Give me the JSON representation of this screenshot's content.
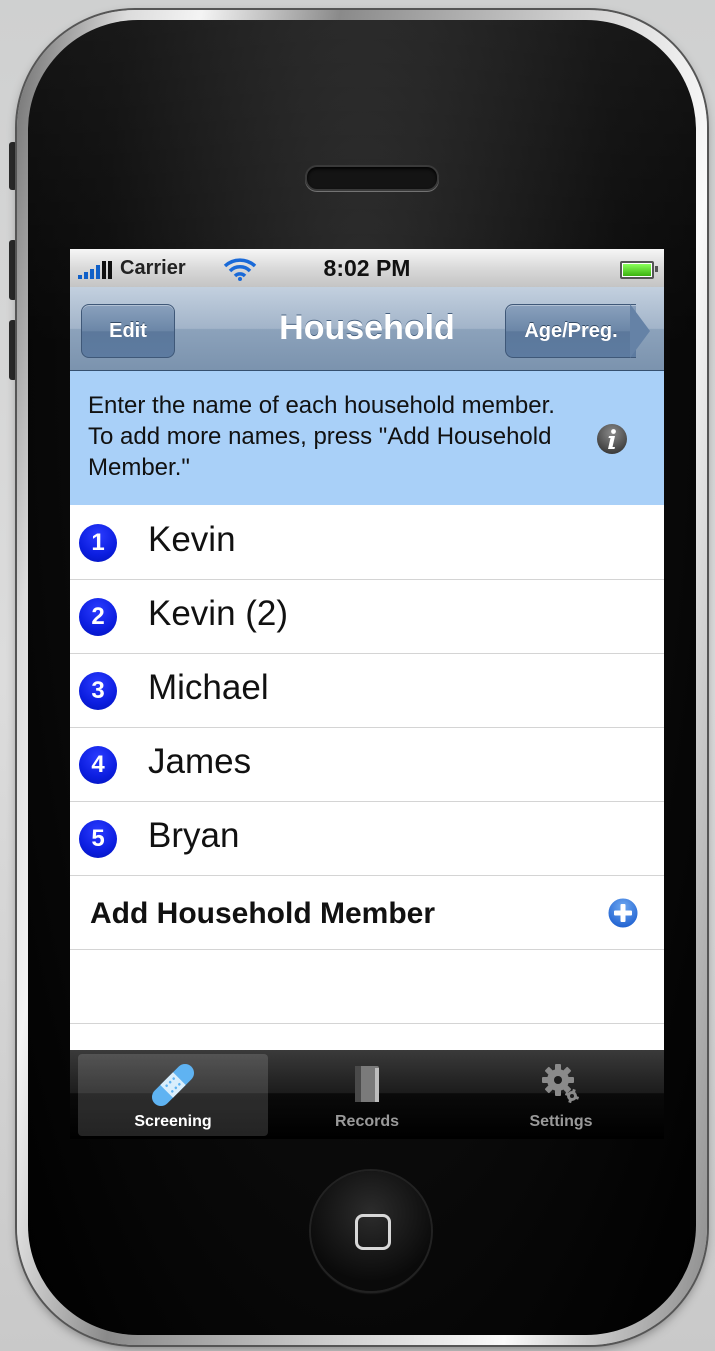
{
  "status_bar": {
    "carrier": "Carrier",
    "time": "8:02 PM"
  },
  "nav_bar": {
    "title": "Household",
    "left_button": "Edit",
    "right_button": "Age/Preg."
  },
  "info": {
    "text": "Enter the name of each household member. To add more names, press \"Add Household Member.\"",
    "icon": "info-icon"
  },
  "members": [
    {
      "number": "1",
      "name": "Kevin"
    },
    {
      "number": "2",
      "name": "Kevin (2)"
    },
    {
      "number": "3",
      "name": "Michael"
    },
    {
      "number": "4",
      "name": "James"
    },
    {
      "number": "5",
      "name": "Bryan"
    }
  ],
  "add_member": {
    "label": "Add Household Member",
    "icon": "plus-icon"
  },
  "tabs": [
    {
      "label": "Screening",
      "icon": "bandage-icon",
      "selected": true
    },
    {
      "label": "Records",
      "icon": "book-icon",
      "selected": false
    },
    {
      "label": "Settings",
      "icon": "gear-icon",
      "selected": false
    }
  ],
  "colors": {
    "info_band": "#a9d0f8",
    "badge": "#0c1ee0",
    "nav_bar": "#8ca2bb",
    "add_icon": "#2a6fd8"
  }
}
